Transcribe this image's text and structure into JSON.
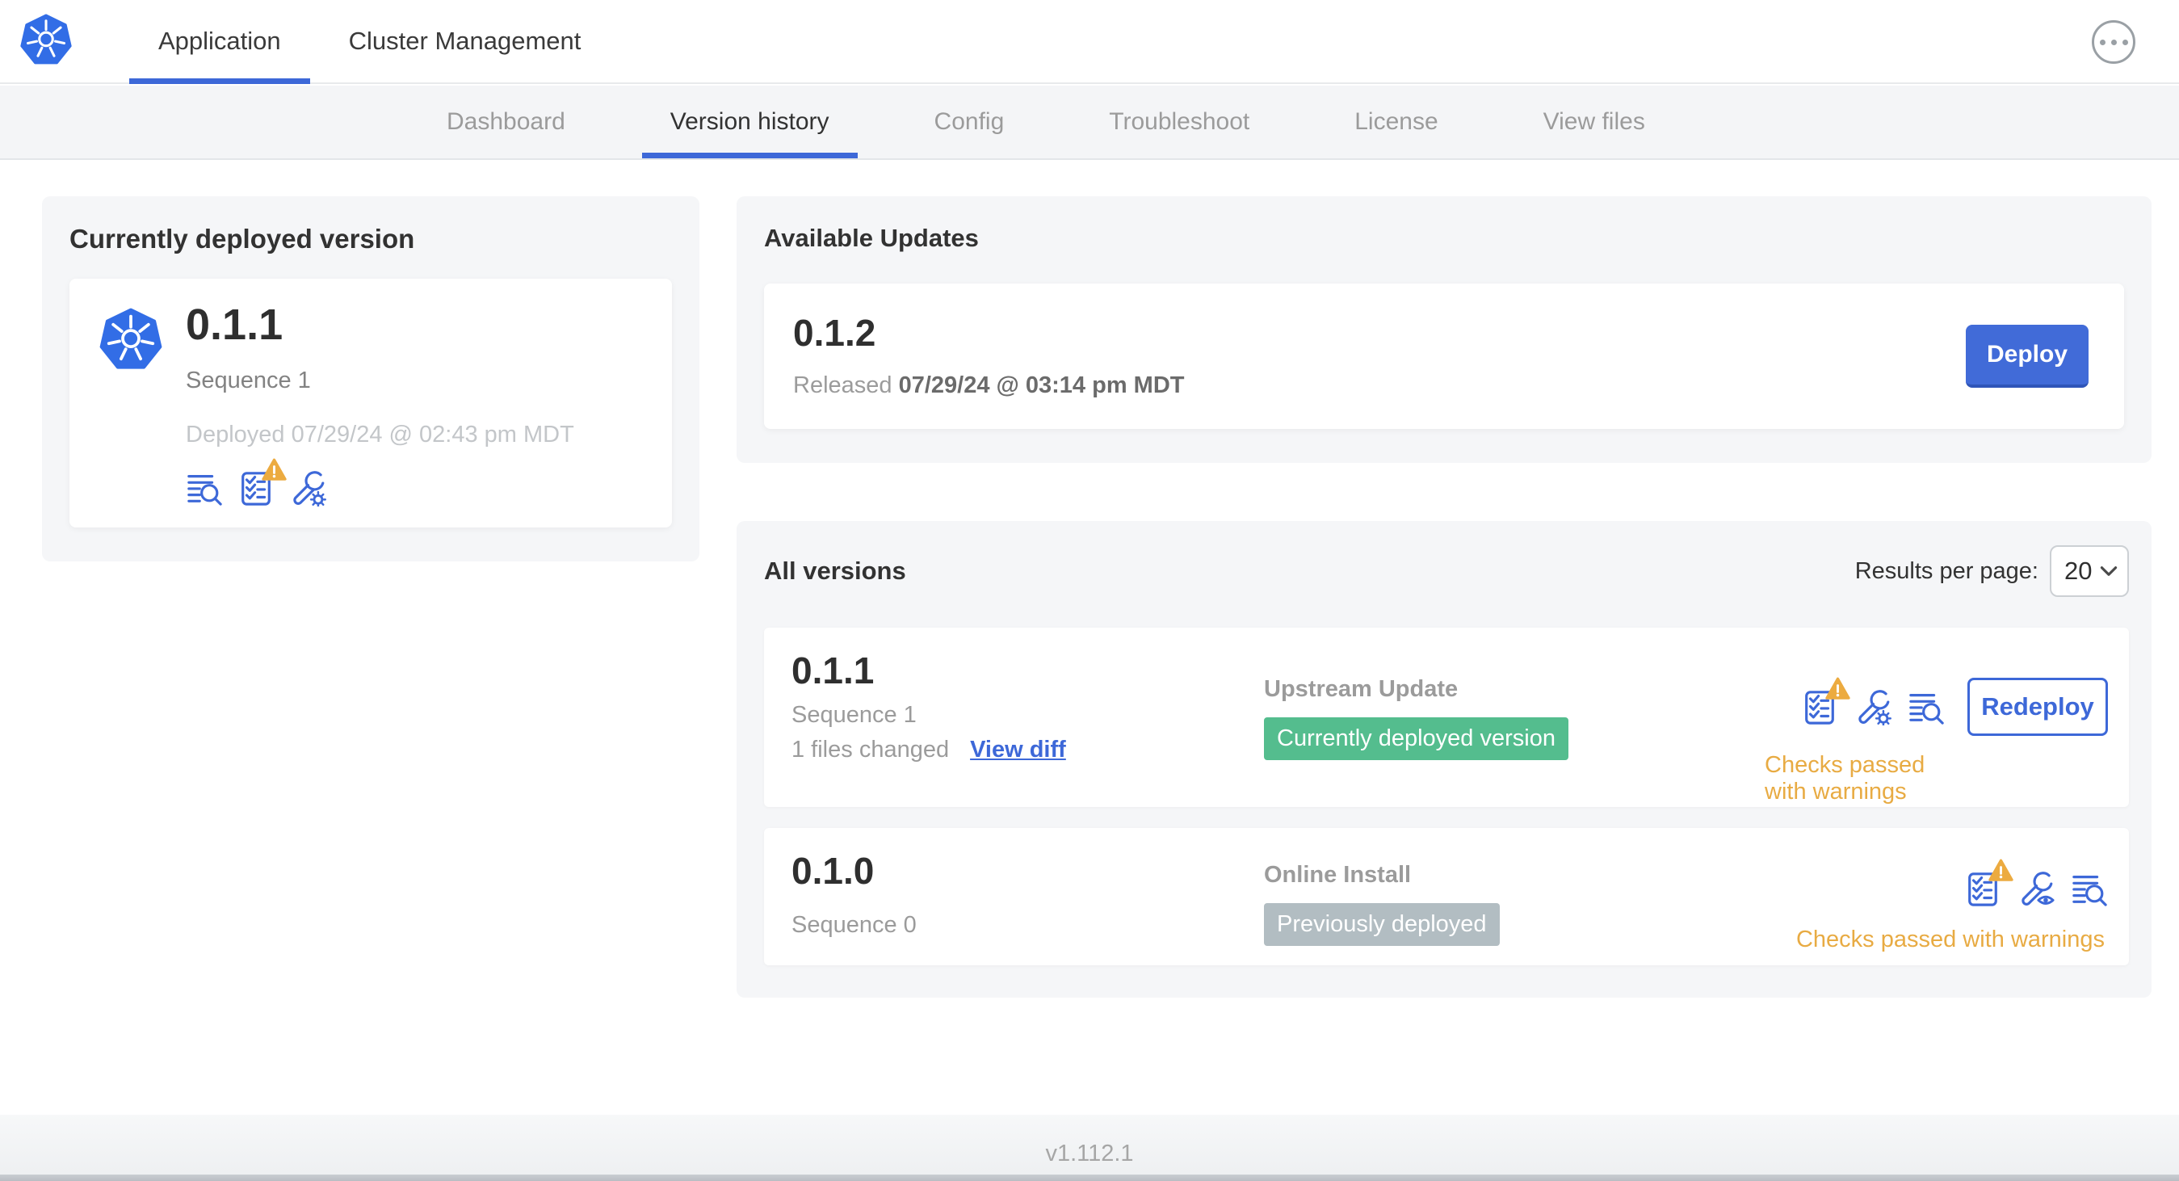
{
  "header": {
    "tabs": [
      {
        "label": "Application"
      },
      {
        "label": "Cluster Management"
      }
    ],
    "more_icon": "ellipsis-menu"
  },
  "subnav": {
    "tabs": [
      {
        "label": "Dashboard"
      },
      {
        "label": "Version history"
      },
      {
        "label": "Config"
      },
      {
        "label": "Troubleshoot"
      },
      {
        "label": "License"
      },
      {
        "label": "View files"
      }
    ],
    "active": "Version history"
  },
  "current": {
    "title": "Currently deployed version",
    "version": "0.1.1",
    "sequence": "Sequence 1",
    "deployed": "Deployed 07/29/24 @ 02:43 pm MDT",
    "icons": [
      "diff-search",
      "checklist-warning",
      "wrench-gear"
    ]
  },
  "updates": {
    "title": "Available Updates",
    "version": "0.1.2",
    "released_label": "Released",
    "released_date": "07/29/24 @ 03:14 pm MDT",
    "deploy_label": "Deploy"
  },
  "all_versions": {
    "title": "All versions",
    "results_label": "Results per page:",
    "results_value": "20",
    "rows": [
      {
        "version": "0.1.1",
        "sequence": "Sequence 1",
        "files_changed": "1 files changed",
        "view_diff_label": "View diff",
        "source": "Upstream Update",
        "badge": "Currently deployed version",
        "badge_color": "#54bd8e",
        "icons": [
          "checklist-warning",
          "wrench-gear",
          "diff-search"
        ],
        "action_label": "Redeploy",
        "status": "Checks passed with warnings"
      },
      {
        "version": "0.1.0",
        "sequence": "Sequence 0",
        "source": "Online Install",
        "badge": "Previously deployed",
        "badge_color": "#b2bdc2",
        "icons": [
          "checklist-warning",
          "wrench-eye",
          "diff-search"
        ],
        "status": "Checks passed with warnings"
      }
    ]
  },
  "footer": {
    "version": "v1.112.1"
  },
  "colors": {
    "accent_blue": "#3d68d8",
    "logo_blue": "#326de6",
    "green_badge": "#54bd8e",
    "gray_badge": "#b2bdc2",
    "warning_orange": "#ecab40",
    "warning_text": "#e8ab43",
    "panel_gray": "#f5f6f8"
  }
}
